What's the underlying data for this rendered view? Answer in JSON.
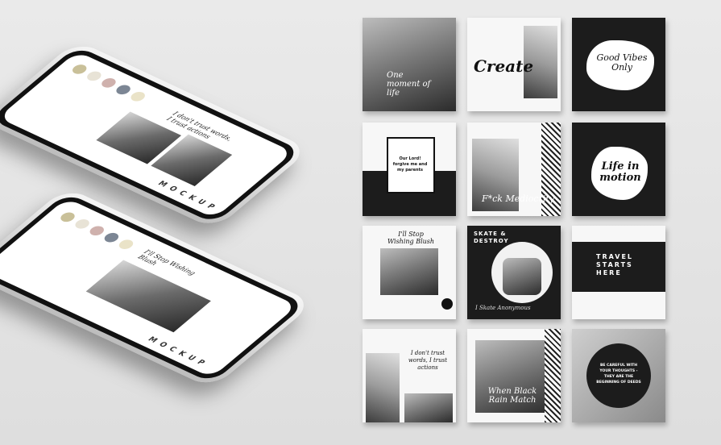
{
  "phones": {
    "top": {
      "mock_label": "MOCKUP",
      "quote": "I don't trust words, I trust actions",
      "swatches": [
        "#c9c099",
        "#e8e3d6",
        "#cfb1ad",
        "#7c8694",
        "#eae3c8"
      ]
    },
    "bottom": {
      "mock_label": "MOCKUP",
      "quote": "I'll Stop Wishing Blush",
      "swatches": [
        "#c9c099",
        "#e8e3d6",
        "#cfb1ad",
        "#7c8694",
        "#eae3c8"
      ]
    }
  },
  "tiles": {
    "t1": {
      "text": "One moment of life"
    },
    "t2": {
      "text": "Create"
    },
    "t3": {
      "text": "Good Vibes Only"
    },
    "t4": {
      "text": "Our Lord! forgive me and my parents"
    },
    "t5": {
      "text": "F*ck Mediocrity"
    },
    "t6": {
      "text": "Life in motion"
    },
    "t7": {
      "text": "I'll Stop Wishing Blush"
    },
    "t8": {
      "text": "SKATE & DESTROY",
      "sub": "I Skate Anonymous"
    },
    "t9": {
      "text": "TRAVEL STARTS HERE"
    },
    "t10": {
      "text": "I don't trust words, I trust actions"
    },
    "t11": {
      "text": "When Black Rain Match"
    },
    "t12": {
      "text": "BE CAREFUL WITH YOUR THOUGHTS - THEY ARE THE BEGINNING OF DEEDS"
    }
  },
  "colors": {
    "dark": "#1c1c1c",
    "light": "#f7f7f7",
    "background": "#e6e6e6"
  }
}
